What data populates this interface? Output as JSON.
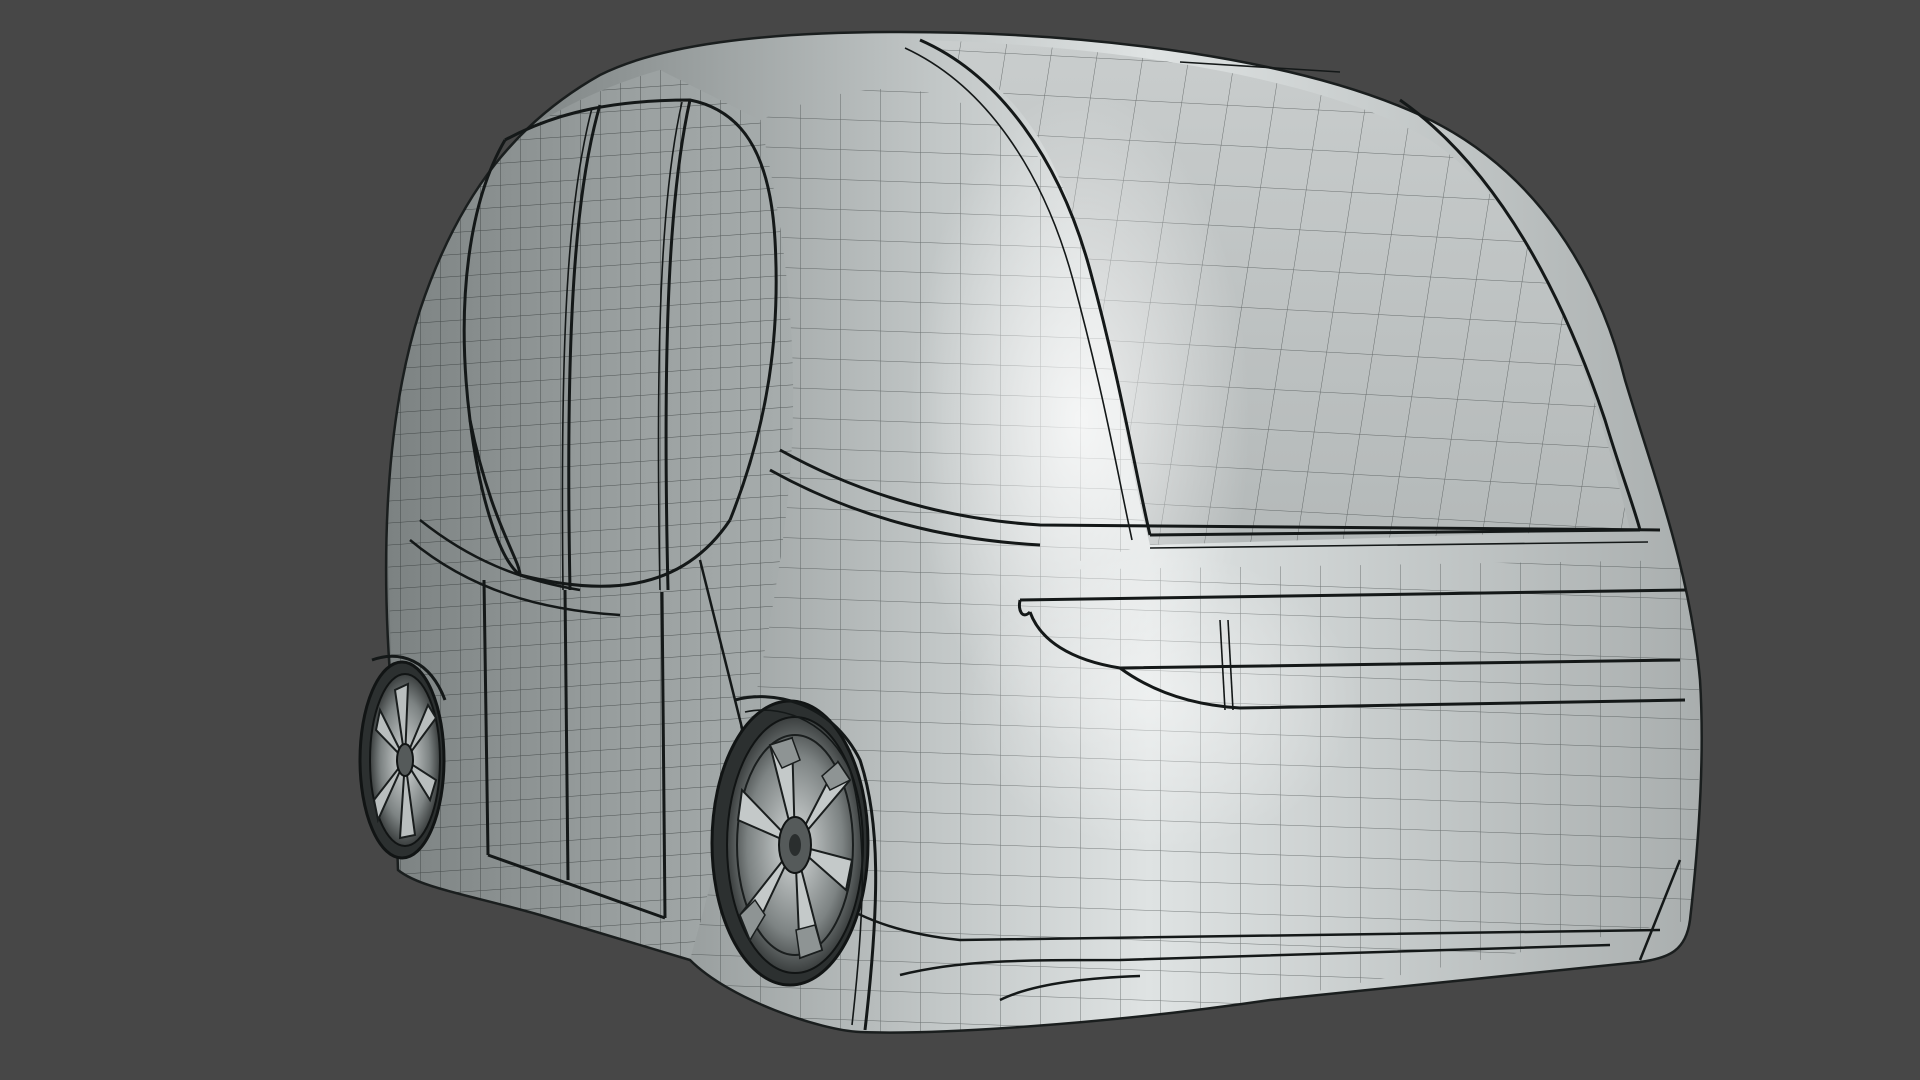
{
  "viewport": {
    "background_color": "#474747",
    "shading": "solid-with-wireframe"
  },
  "model": {
    "subject": "autonomous-shuttle-pod",
    "view": "rear-three-quarter",
    "body_color": "#9ea3a3",
    "highlight_color": "#e4e7e7",
    "wire_color": "#1f2323",
    "wheel_count_visible": 2
  }
}
